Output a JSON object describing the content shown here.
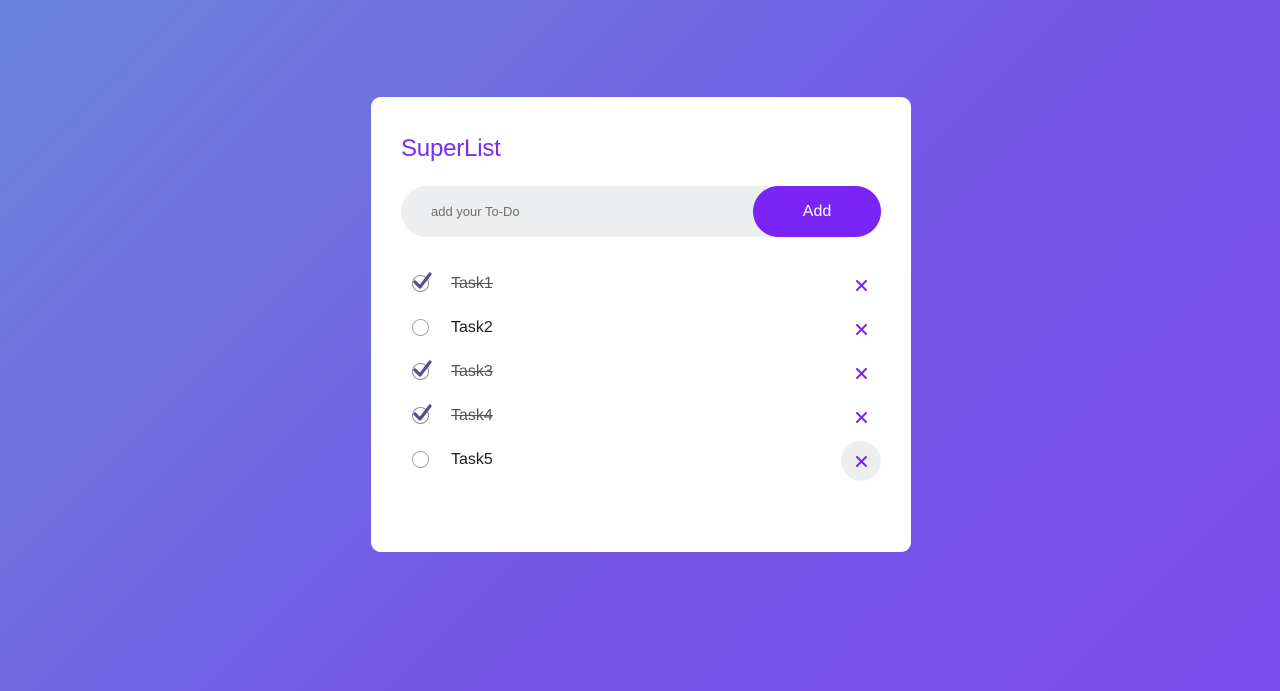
{
  "app": {
    "title": "SuperList"
  },
  "input": {
    "placeholder": "add your To-Do",
    "value": "",
    "add_label": "Add"
  },
  "tasks": [
    {
      "label": "Task1",
      "done": true
    },
    {
      "label": "Task2",
      "done": false
    },
    {
      "label": "Task3",
      "done": true
    },
    {
      "label": "Task4",
      "done": true
    },
    {
      "label": "Task5",
      "done": false
    }
  ],
  "icons": {
    "check": "check-icon",
    "delete": "close-icon"
  },
  "colors": {
    "accent": "#7a25f5",
    "title": "#7a2cf0",
    "input_bg": "#edeef0",
    "check": "#5b4c8f"
  }
}
